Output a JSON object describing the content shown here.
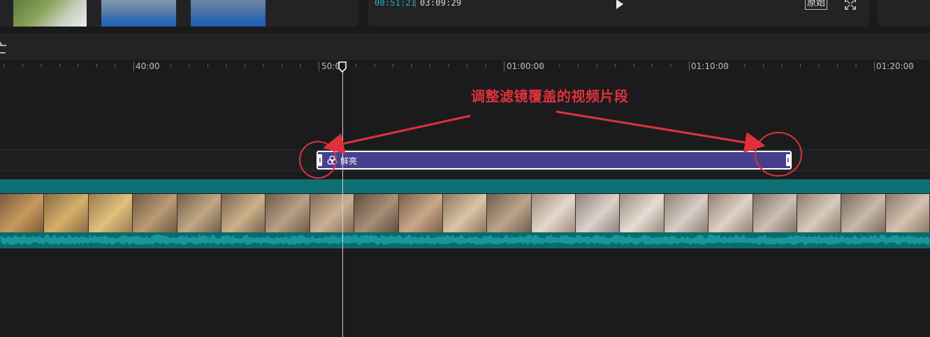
{
  "preview": {
    "current_time": "00:51:21",
    "total_time": "03:09:29",
    "original_ratio_label": "原始",
    "play_icon": "play-icon",
    "fullscreen_icon": "fullscreen-icon"
  },
  "toolbar": {
    "partial_glyph": "亡"
  },
  "ruler": {
    "labels": [
      "40:00",
      "50:00",
      "01:00:00",
      "01:10:00",
      "01:20:00"
    ]
  },
  "filter_clip": {
    "label": "鲜亮",
    "icon": "filter-icon"
  },
  "annotation": {
    "text": "调整滤镜覆盖的视频片段",
    "color": "#e0313a"
  },
  "colors": {
    "accent_timecode": "#2ab3b8",
    "filter_clip": "#463f8f",
    "video_track": "#0f6f72"
  }
}
